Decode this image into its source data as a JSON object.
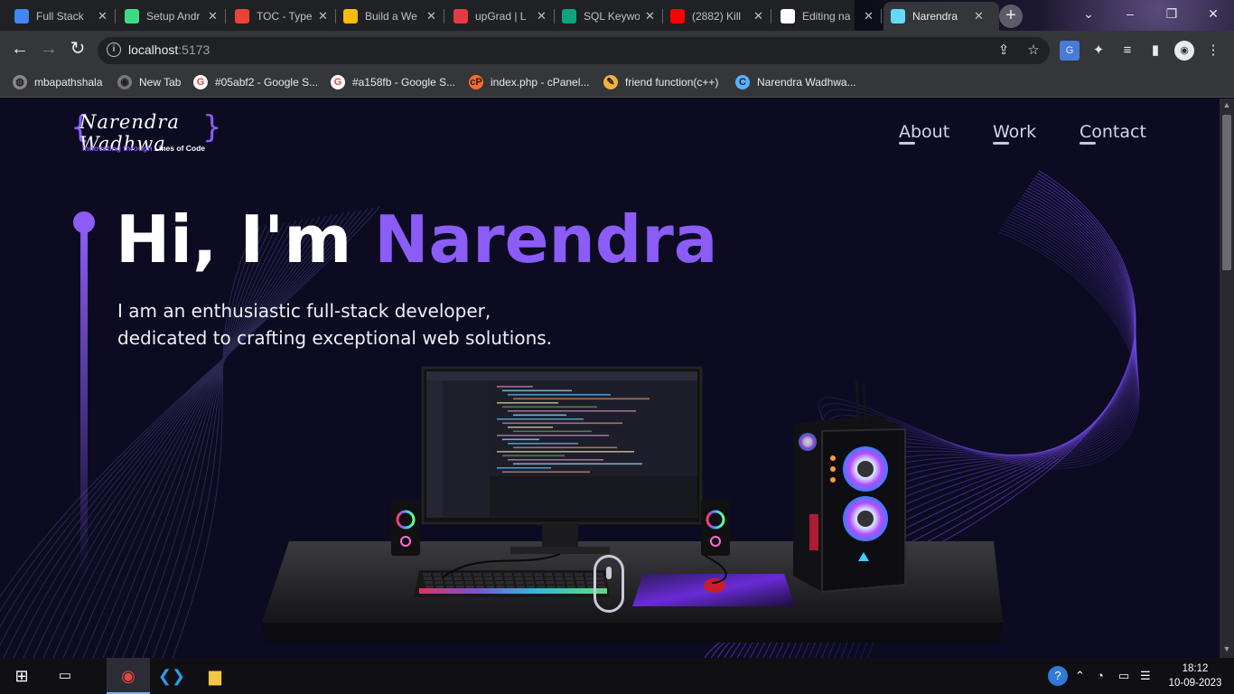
{
  "browser": {
    "tabs": [
      {
        "title": "Full Stack",
        "icon": "docs-icon",
        "color": "#4285f4"
      },
      {
        "title": "Setup Andr",
        "icon": "android-icon",
        "color": "#3ddc84"
      },
      {
        "title": "TOC - Type",
        "icon": "toc-icon",
        "color": "#ea4335"
      },
      {
        "title": "Build a We",
        "icon": "cloud-icon",
        "color": "#fbbc04"
      },
      {
        "title": "upGrad | L",
        "icon": "upgrad-icon",
        "color": "#e63946"
      },
      {
        "title": "SQL Keywo",
        "icon": "chatgpt-icon",
        "color": "#10a37f"
      },
      {
        "title": "(2882) Kill",
        "icon": "youtube-icon",
        "color": "#ff0000"
      },
      {
        "title": "Editing na",
        "icon": "github-icon",
        "color": "#ffffff"
      },
      {
        "title": "Narendra",
        "icon": "react-icon",
        "color": "#61dafb",
        "active": true
      }
    ],
    "url_host": "localhost",
    "url_port": ":5173",
    "bookmarks": [
      {
        "label": "mbapathshala",
        "icon": "mba-icon"
      },
      {
        "label": "New Tab",
        "icon": "globe-icon"
      },
      {
        "label": "#05abf2 - Google S...",
        "icon": "google-icon"
      },
      {
        "label": "#a158fb - Google S...",
        "icon": "google-icon"
      },
      {
        "label": "index.php - cPanel...",
        "icon": "cpanel-icon"
      },
      {
        "label": "friend function(c++)",
        "icon": "bookmark-icon"
      },
      {
        "label": "Narendra Wadhwa...",
        "icon": "site-icon"
      }
    ]
  },
  "site": {
    "logo": {
      "script": "Narendra Wadhwa",
      "tagline_a": "Innovating through",
      "tagline_b": "Lines of Code"
    },
    "nav": [
      "About",
      "Work",
      "Contact"
    ],
    "hero": {
      "greeting": "Hi, I'm",
      "name": "Narendra",
      "subtitle_line1": "I am an enthusiastic full-stack developer,",
      "subtitle_line2": "dedicated to crafting exceptional web solutions."
    },
    "accent_color": "#8b5cf6"
  },
  "taskbar": {
    "time": "18:12",
    "date": "10-09-2023"
  }
}
